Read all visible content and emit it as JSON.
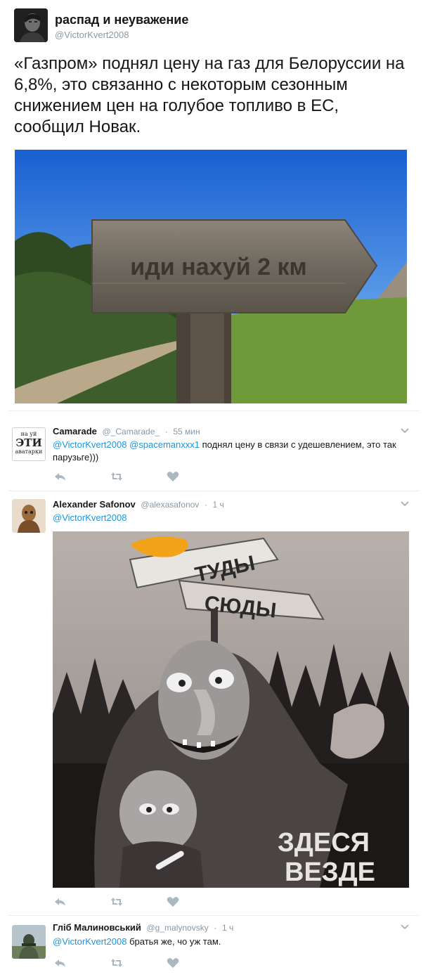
{
  "main_tweet": {
    "display_name": "распад и неуважение",
    "handle": "@VictorKvert2008",
    "text": "«Газпром» поднял цену на газ для Белоруссии на 6,8%, это связанно с некоторым сезонным снижением цен на голубое топливо в ЕС, сообщил Новак.",
    "image_sign_text": "иди нахуй 2 км"
  },
  "replies": [
    {
      "display_name": "Camarade",
      "handle": "@_Camarade_",
      "time": "55 мин",
      "avatar_lines": [
        "на уй",
        "ЭТИ",
        "аватарки"
      ],
      "mentions": "@VictorKvert2008 @spacemanxxx1",
      "text": " поднял цену в связи с удешевлением, это так парузьге)))"
    },
    {
      "display_name": "Alexander Safonov",
      "handle": "@alexasafonov",
      "time": "1 ч",
      "mentions": "@VictorKvert2008",
      "text": "",
      "image_texts": {
        "sign_top": "ТУДЫ",
        "sign_bottom": "СЮДЫ",
        "caption_line1": "ЗДЕСЯ",
        "caption_line2": "ВЕЗДЕ"
      }
    },
    {
      "display_name": "Гліб Малиновський",
      "handle": "@g_malynovsky",
      "time": "1 ч",
      "mentions": "@VictorKvert2008",
      "text": " братья же, чо уж там."
    }
  ],
  "icons": {
    "reply": "reply-icon",
    "retweet": "retweet-icon",
    "like": "heart-icon",
    "menu": "chevron-down-icon"
  },
  "colors": {
    "link": "#1b95e0",
    "muted": "#8899a6",
    "icon": "#aab8c2"
  }
}
